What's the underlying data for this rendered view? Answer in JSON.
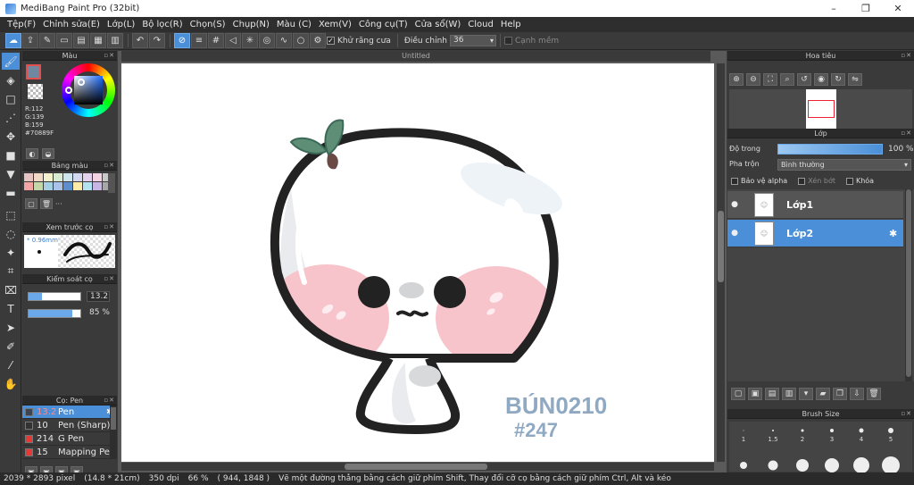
{
  "window": {
    "title": "MediBang Paint Pro (32bit)",
    "controls": [
      "–",
      "❐",
      "✕"
    ]
  },
  "menu": [
    "Tệp(F)",
    "Chỉnh sửa(E)",
    "Lớp(L)",
    "Bộ lọc(R)",
    "Chọn(S)",
    "Chụp(N)",
    "Màu (C)",
    "Xem(V)",
    "Công cụ(T)",
    "Cửa sổ(W)",
    "Cloud",
    "Help"
  ],
  "toolbar": {
    "antialias_label": "Khử răng cưa",
    "adjust_label": "Điều chỉnh",
    "adjust_value": "36",
    "sharp_label": "Cạnh mềm"
  },
  "color_panel": {
    "title": "Màu",
    "r": "R:112",
    "g": "G:139",
    "b": "B:159",
    "hex": "#70889F",
    "fg_color": "#70889f"
  },
  "palette_panel": {
    "title": "Bảng màu",
    "extra": "···",
    "colors": [
      "#e7c4c4",
      "#f1d9c6",
      "#f4f1cd",
      "#d7ecd1",
      "#cfe5ee",
      "#d3d7ef",
      "#e4d2ee",
      "#f3d3e4",
      "#c9c9c9",
      "#f2a3a3",
      "#c3d7a8",
      "#a6cfe2",
      "#aac2e8",
      "#5b8fce",
      "#ffeaa7",
      "#b3e3ef",
      "#c7b5e6",
      "#a7a7a7"
    ]
  },
  "brush_preview": {
    "title": "Xem trước cọ",
    "size": "* 0.96mm"
  },
  "brush_control": {
    "title": "Kiểm soát cọ",
    "size_value": "13.2",
    "size_level": 0.25,
    "opacity_value": "85 %",
    "opacity_level": 0.85
  },
  "brush_list": {
    "title": "Cọ: Pen",
    "items": [
      {
        "num": "13.2",
        "name": "Pen",
        "color": "#3a4655",
        "selected": true
      },
      {
        "num": "10",
        "name": "Pen (Sharp)",
        "color": "#333333",
        "selected": false
      },
      {
        "num": "214",
        "name": "G Pen",
        "color": "#e53935",
        "selected": false
      },
      {
        "num": "15",
        "name": "Mapping Pen",
        "color": "#e53935",
        "selected": false
      }
    ]
  },
  "canvas": {
    "tab_title": "Untitled",
    "signature_1": "BÚN0210",
    "signature_2": "#247"
  },
  "navigator": {
    "title": "Hoa tiêu"
  },
  "layer_panel": {
    "title": "Lớp",
    "opacity_label": "Độ trong",
    "opacity_value": "100 %",
    "blend_label": "Pha trộn",
    "blend_value": "Bình thường",
    "protect_alpha": "Bảo vệ alpha",
    "clipping": "Xén bớt",
    "lock": "Khóa",
    "layers": [
      {
        "name": "Lớp1",
        "selected": false
      },
      {
        "name": "Lớp2",
        "selected": true
      }
    ]
  },
  "brush_size_panel": {
    "title": "Brush Size",
    "sizes": [
      "1",
      "1.5",
      "2",
      "3",
      "4",
      "5"
    ]
  },
  "status": {
    "dimensions": "2039 * 2893 pixel",
    "physical": "(14.8 * 21cm)",
    "dpi": "350 dpi",
    "zoom": "66 %",
    "coords": "( 944, 1848 )",
    "hint": "Vẽ một đường thẳng bằng cách giữ phím Shift, Thay đổi cỡ cọ bằng cách giữ phím Ctrl, Alt và kéo"
  }
}
